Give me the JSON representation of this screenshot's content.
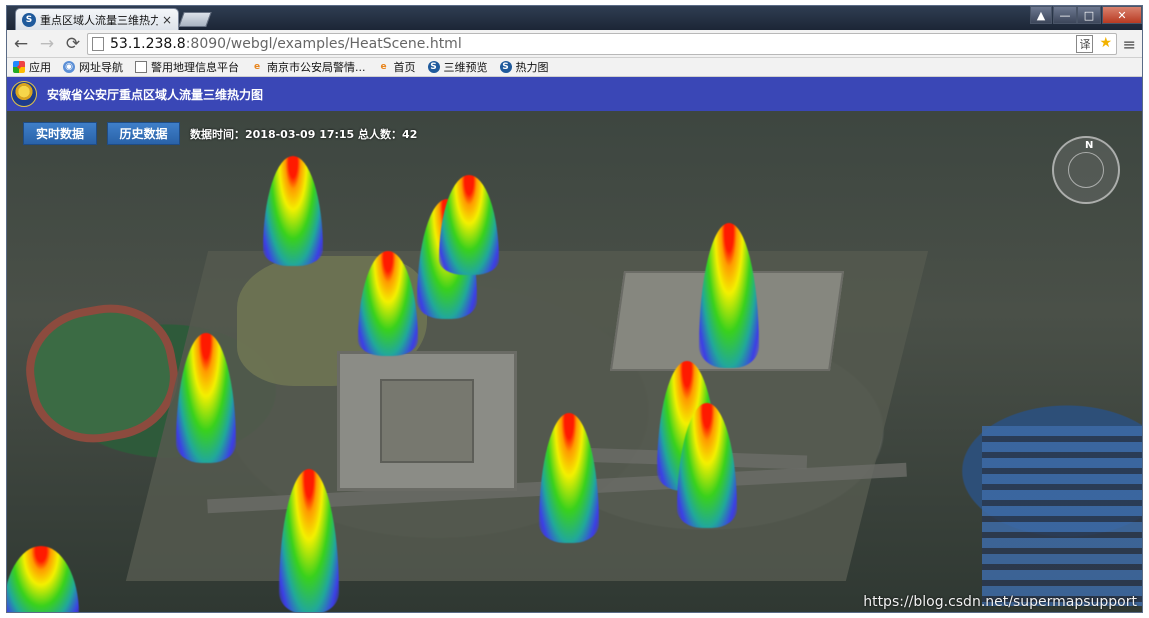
{
  "browser": {
    "tab_title": "重点区域人流量三维热力图",
    "tab_close": "×",
    "favicon": "S",
    "window_controls": {
      "user": "▲",
      "minimize": "—",
      "maximize": "□",
      "close": "✕"
    },
    "nav": {
      "back": "←",
      "forward": "→",
      "reload": "⟳"
    },
    "url_host": "53.1.238.8",
    "url_rest": ":8090/webgl/examples/HeatScene.html",
    "menu": "≡",
    "star": "★",
    "translate": "译"
  },
  "bookmarks": [
    {
      "label": "应用",
      "icon": "apps-icon"
    },
    {
      "label": "网址导航",
      "icon": "globe-icon"
    },
    {
      "label": "警用地理信息平台",
      "icon": "doc-icon"
    },
    {
      "label": "南京市公安局警情...",
      "icon": "ie-icon"
    },
    {
      "label": "首页",
      "icon": "ie-icon"
    },
    {
      "label": "三维预览",
      "icon": "sm-icon"
    },
    {
      "label": "热力图",
      "icon": "sm-icon"
    }
  ],
  "app": {
    "title": "安徽省公安厅重点区域人流量三维热力图"
  },
  "controls": {
    "realtime_button": "实时数据",
    "history_button": "历史数据",
    "info_text": "数据时间：2018-03-09 17:15 总人数：42"
  },
  "compass_label": "N",
  "watermark": "https://blog.csdn.net/supermapsupport",
  "heat_colors": {
    "peak": "#ff1a00",
    "mid": "#f3f000",
    "low": "#39d11c",
    "base": "#3d3de6"
  }
}
